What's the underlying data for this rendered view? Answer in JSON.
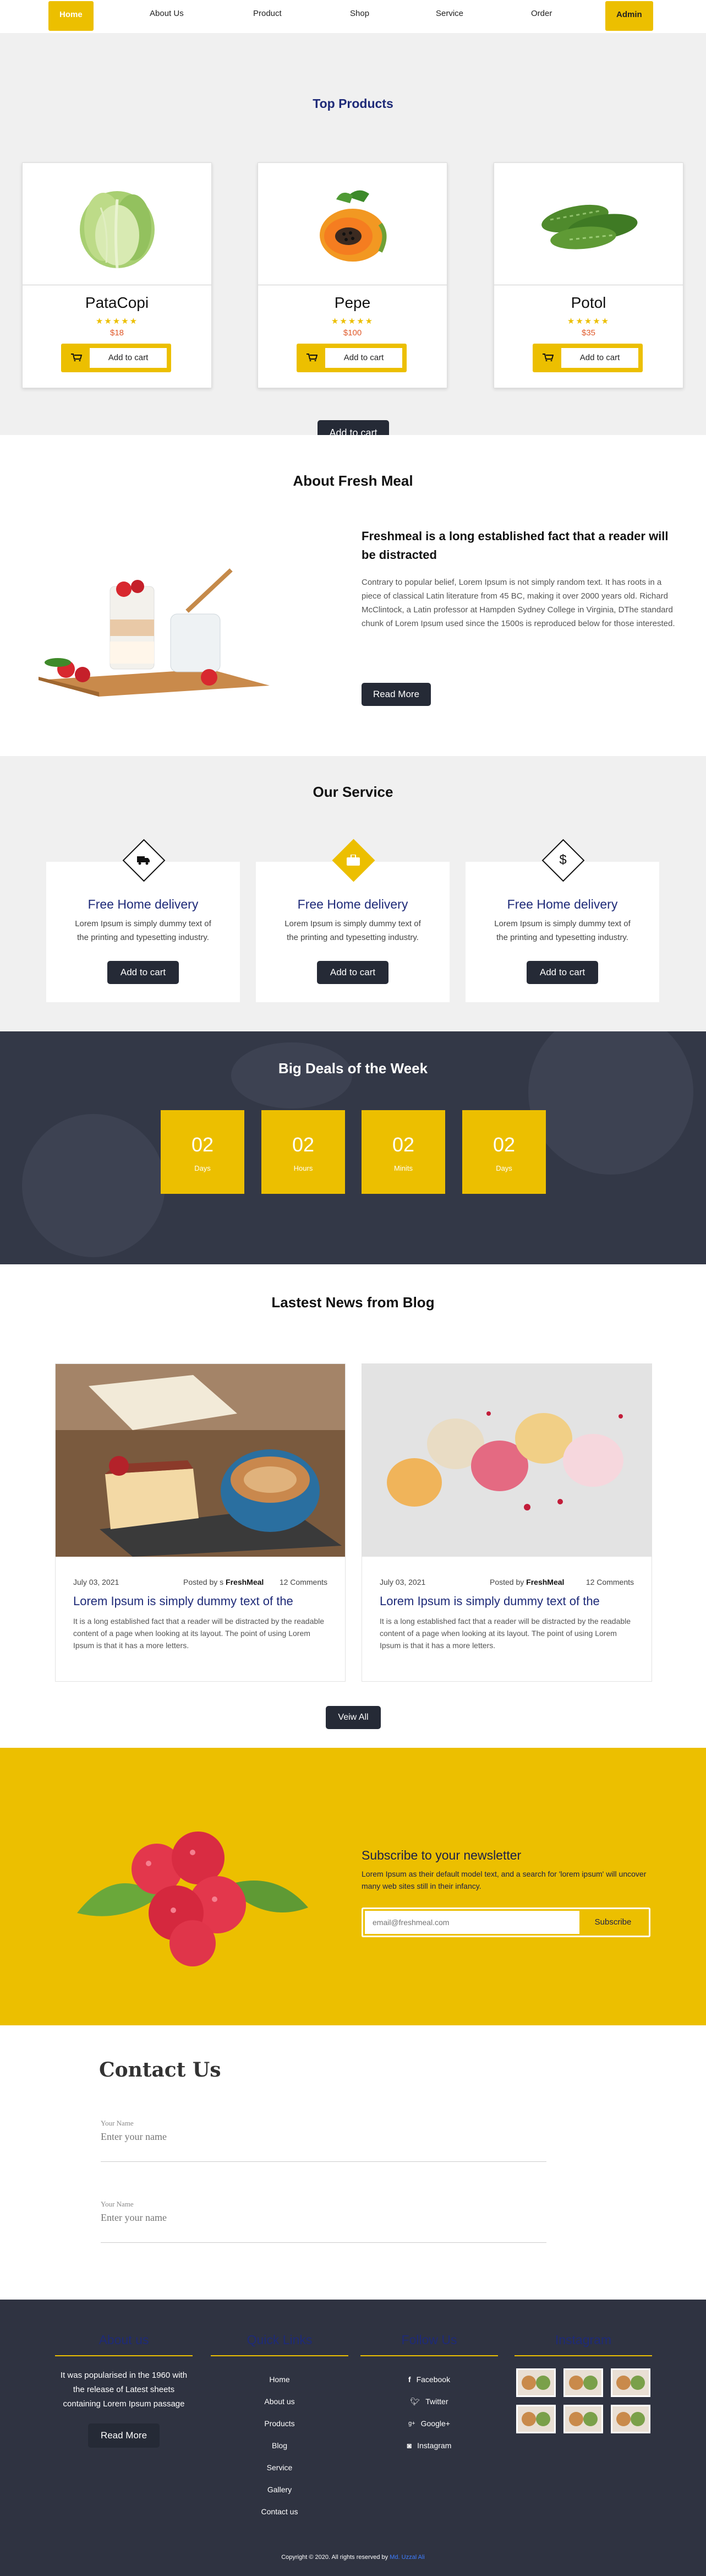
{
  "nav": {
    "home": "Home",
    "about": "About Us",
    "product": "Product",
    "shop": "Shop",
    "service": "Service",
    "order": "Order",
    "admin": "Admin"
  },
  "top_products": {
    "title": "Top Products",
    "button": "Add to cart",
    "products": [
      {
        "name": "PataCopi",
        "stars": "★★★★★",
        "price": "$18",
        "cart_label": "Add to cart"
      },
      {
        "name": "Pepe",
        "stars": "★★★★★",
        "price": "$100",
        "cart_label": "Add to cart"
      },
      {
        "name": "Potol",
        "stars": "★★★★★",
        "price": "$35",
        "cart_label": "Add to cart"
      }
    ]
  },
  "about": {
    "title": "About Fresh Meal",
    "headline": "Freshmeal is a long established fact that a reader will be distracted",
    "body": "Contrary to popular belief, Lorem Ipsum is not simply random text. It has roots in a piece of classical Latin literature from 45 BC, making it over 2000 years old. Richard McClintock, a Latin professor at Hampden Sydney College in Virginia, DThe standard chunk of Lorem Ipsum used since the 1500s is reproduced below for those interested.",
    "button": "Read More"
  },
  "service": {
    "title": "Our Service",
    "cards": [
      {
        "title": "Free Home delivery",
        "text": "Lorem Ipsum is simply dummy text of the printing and typesetting industry.",
        "button": "Add to cart",
        "icon": "truck-icon"
      },
      {
        "title": "Free Home delivery",
        "text": "Lorem Ipsum is simply dummy text of the printing and typesetting industry.",
        "button": "Add to cart",
        "icon": "briefcase-icon"
      },
      {
        "title": "Free Home delivery",
        "text": "Lorem Ipsum is simply dummy text of the printing and typesetting industry.",
        "button": "Add to cart",
        "icon": "dollar-icon"
      }
    ]
  },
  "deals": {
    "title": "Big Deals of the Week",
    "boxes": [
      {
        "value": "02",
        "unit": "Days"
      },
      {
        "value": "02",
        "unit": "Hours"
      },
      {
        "value": "02",
        "unit": "Minits"
      },
      {
        "value": "02",
        "unit": "Days"
      }
    ]
  },
  "blog": {
    "title": "Lastest News from Blog",
    "button": "Veiw All",
    "posts": [
      {
        "date": "July 03, 2021",
        "posted_by": "Posted by ",
        "prefix": "s ",
        "author": "FreshMeal",
        "comments": "12 Comments",
        "title": "Lorem Ipsum is simply dummy text of the",
        "text": "It is a long established fact that a reader will be distracted by the readable content of a page when looking at its layout. The point of using Lorem Ipsum is that it has a more letters."
      },
      {
        "date": "July 03, 2021",
        "posted_by": "Posted by ",
        "prefix": "",
        "author": "FreshMeal",
        "comments": "12 Comments",
        "title": "Lorem Ipsum is simply dummy text of the",
        "text": "It is a long established fact that a reader will be distracted by the readable content of a page when looking at its layout. The point of using Lorem Ipsum is that it has a more letters."
      }
    ]
  },
  "newsletter": {
    "title": "Subscribe to your newsletter",
    "text": "Lorem Ipsum as their default model text, and a search for 'lorem ipsum' will uncover many web sites still in their infancy.",
    "placeholder": "email@freshmeal.com",
    "button": "Subscribe"
  },
  "contact": {
    "title": "Contact Us",
    "fields": [
      {
        "label": "Your Name",
        "placeholder": "Enter your name"
      },
      {
        "label": "Your Name",
        "placeholder": "Enter your name"
      }
    ]
  },
  "footer": {
    "about": {
      "title": "About us",
      "text": "It was popularised in the 1960 with the release of Latest sheets containing Lorem Ipsum passage",
      "button": "Read More"
    },
    "quick_links": {
      "title": "Quick Links",
      "items": [
        "Home",
        "About us",
        "Products",
        "Blog",
        "Service",
        "Gallery",
        "Contact us"
      ]
    },
    "follow": {
      "title": "Follow Us",
      "items": [
        {
          "label": "Facebook",
          "icon": "facebook-icon"
        },
        {
          "label": "Twitter",
          "icon": "twitter-icon"
        },
        {
          "label": "Google+",
          "icon": "google-plus-icon"
        },
        {
          "label": "Instagram",
          "icon": "instagram-icon"
        }
      ]
    },
    "instagram": {
      "title": "Instagram"
    },
    "copyright": "Copyright © 2020. All rights reserved by ",
    "copyright_link": "Md. Uzzal Ali"
  },
  "colors": {
    "accent": "#ecbf00",
    "dark": "#252a36",
    "navy": "#1e2a78",
    "footer": "#2f3341"
  }
}
